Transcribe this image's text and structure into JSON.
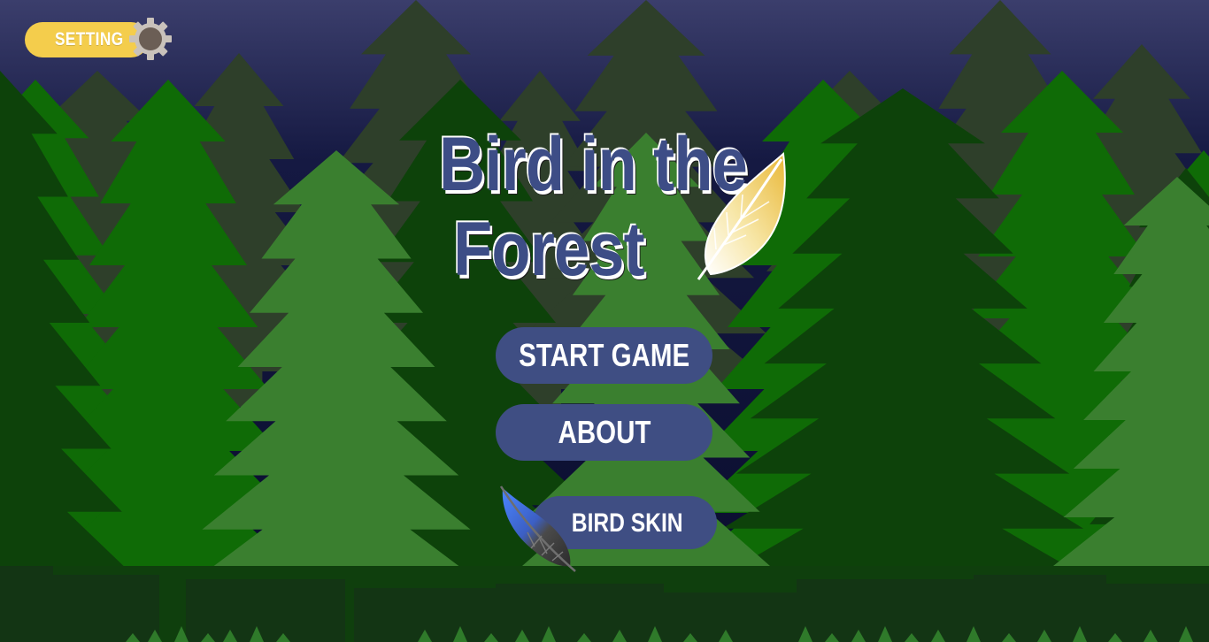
{
  "title": {
    "line1": "Bird in the",
    "line2": "Forest"
  },
  "setting": {
    "label": "SETTING",
    "icon": "gear-icon"
  },
  "menu": {
    "start_label": "START GAME",
    "about_label": "ABOUT",
    "skin_label": "BIRD SKIN"
  },
  "colors": {
    "sky_top": "#3b3e6c",
    "sky_bottom": "#090c2c",
    "button_fill": "#3f4e83",
    "setting_pill": "#f4cd4c",
    "title_fill": "#3d4d86"
  }
}
